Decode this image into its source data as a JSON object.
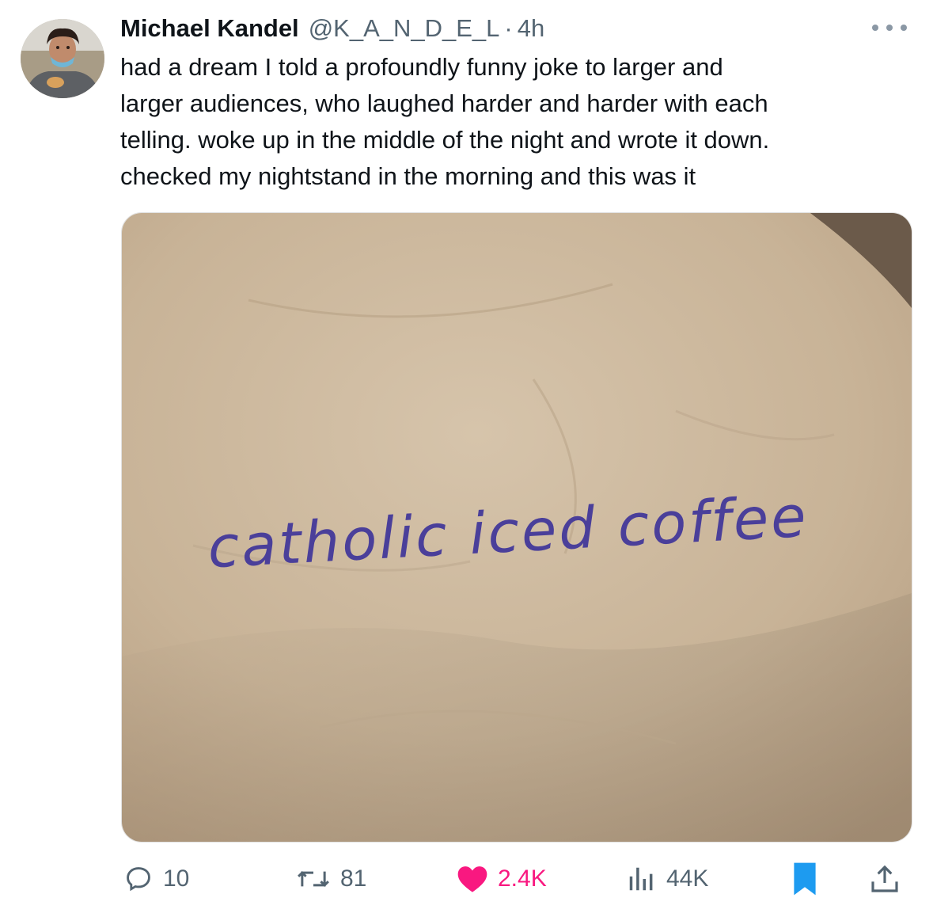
{
  "tweet": {
    "author_name": "Michael Kandel",
    "handle": "@K_A_N_D_E_L",
    "separator": "·",
    "time": "4h",
    "text_lines": [
      "had a dream I told a profoundly funny joke to larger and",
      "larger audiences, who laughed harder and harder with each",
      "telling. woke up in the middle of the night and wrote it down.",
      "checked my nightstand in the morning and this was it"
    ],
    "image": {
      "handwritten_text": "catholic iced coffee",
      "paper_color": "#cbb79c",
      "ink_color": "#4a3f9a"
    }
  },
  "actions": {
    "replies": "10",
    "retweets": "81",
    "likes": "2.4K",
    "views": "44K"
  },
  "icons": {
    "reply": "reply-icon",
    "retweet": "retweet-icon",
    "like": "heart-icon",
    "views": "views-icon",
    "bookmark": "bookmark-icon",
    "share": "share-icon",
    "more": "more-icon"
  },
  "colors": {
    "like": "#f91880",
    "bookmark": "#1d9bf0",
    "text_primary": "#0f1419",
    "text_secondary": "#536471"
  }
}
